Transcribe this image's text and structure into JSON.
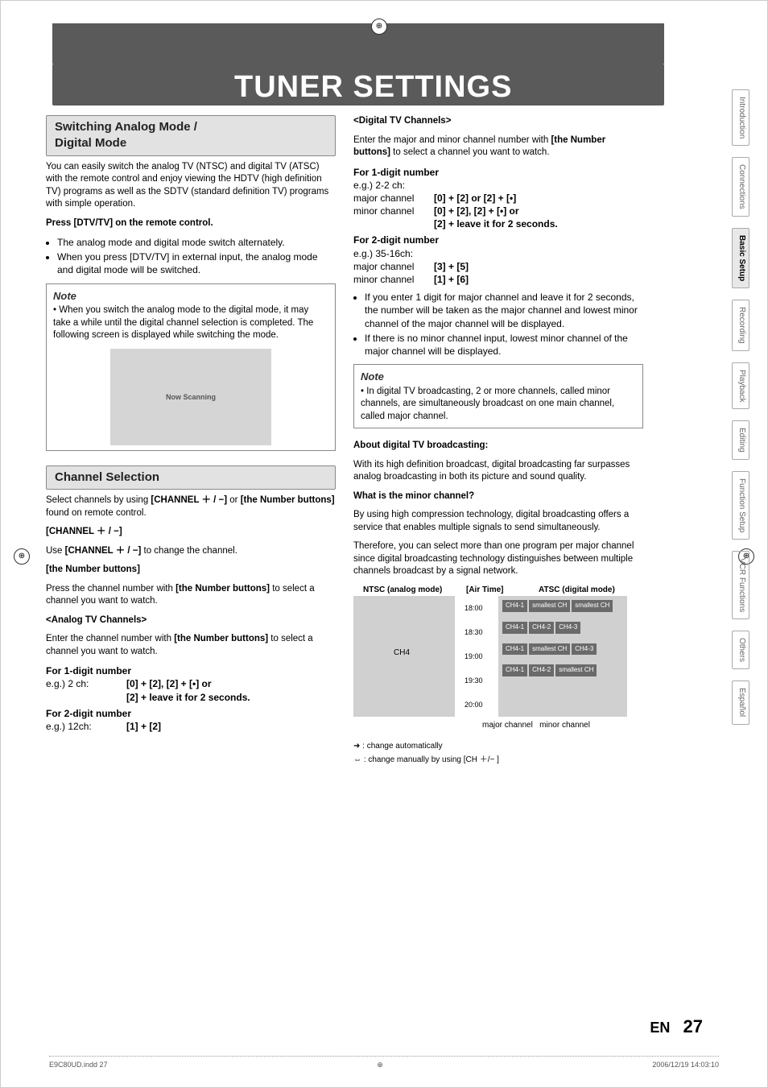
{
  "page": {
    "title": "TUNER SETTINGS",
    "lang": "EN",
    "num": "27",
    "footer_left": "E9C80UD.indd   27",
    "footer_right": "2006/12/19   14:03:10"
  },
  "tabs": [
    "Introduction",
    "Connections",
    "Basic Setup",
    "Recording",
    "Playback",
    "Editing",
    "Function Setup",
    "VCR Functions",
    "Others",
    "Español"
  ],
  "active_tab": "Basic Setup",
  "sec1": {
    "hdr": "Switching Analog Mode /\nDigital Mode",
    "p1": "You can easily switch the analog TV (NTSC) and digital TV (ATSC) with the remote control and enjoy viewing the HDTV (high definition TV) programs as well as the SDTV (standard definition TV) programs with simple operation.",
    "p2": "Press [DTV/TV] on the remote control.",
    "b1": "The analog mode and digital mode switch alternately.",
    "b2": "When you press [DTV/TV] in external input, the analog mode and digital mode will be switched.",
    "note_t": "Note",
    "note_b": "When you switch the analog mode to the digital mode, it may take a while until the digital channel selection is completed. The following screen is displayed while switching the mode.",
    "scan": "Now Scanning"
  },
  "sec2": {
    "hdr": "Channel Selection",
    "p1_a": "Select channels by using ",
    "p1_b": "[CHANNEL ＋ / −]",
    "p1_c": " or ",
    "p1_d": "[the Number buttons]",
    "p1_e": " found on remote control.",
    "h1": "[CHANNEL ＋ / −]",
    "p2_a": "Use ",
    "p2_b": "[CHANNEL ＋ / −]",
    "p2_c": " to change the channel.",
    "h2": "[the Number buttons]",
    "p3_a": "Press the channel number with ",
    "p3_b": "[the Number buttons]",
    "p3_c": " to select a channel you want to watch.",
    "h3": "<Analog TV Channels>",
    "p4_a": "Enter the channel number with ",
    "p4_b": "[the Number buttons]",
    "p4_c": " to select a channel you want to watch.",
    "h4": "For 1-digit number",
    "eg1": "e.g.) 2 ch:",
    "eg1v1": "[0] + [2], [2] + [•] or",
    "eg1v2": "[2] + leave it for 2 seconds.",
    "h5": "For 2-digit number",
    "eg2": "e.g.) 12ch:",
    "eg2v": "[1] + [2]"
  },
  "sec3": {
    "h1": "<Digital TV Channels>",
    "p1_a": "Enter the major and minor channel number with ",
    "p1_b": "[the Number buttons]",
    "p1_c": " to select a channel you want to watch.",
    "h2": "For 1-digit number",
    "eg1": "e.g.) 2-2 ch:",
    "mj": "major channel",
    "mn": "minor channel",
    "mjv": "[0] + [2] or [2] + [•]",
    "mnv1": "[0] + [2], [2] + [•] or",
    "mnv2": "[2] + leave it for 2 seconds.",
    "h3": "For 2-digit number",
    "eg2": "e.g.) 35-16ch:",
    "mjv2": "[3] + [5]",
    "mnv3": "[1] + [6]",
    "b1": "If you enter 1 digit for major channel and leave it for 2 seconds, the number will be taken as the major channel and lowest minor channel of the major channel will be displayed.",
    "b2": "If there is no minor channel input, lowest minor channel of the major channel will be displayed.",
    "note_t": "Note",
    "note_b": "In digital TV broadcasting, 2 or more channels, called minor channels, are simultaneously broadcast on one main channel, called major channel.",
    "h4": "About digital TV broadcasting:",
    "p2": "With its high definition broadcast, digital broadcasting far surpasses analog broadcasting in both its picture and sound quality.",
    "h5": "What is the minor channel?",
    "p3": "By using high compression technology, digital broadcasting offers a service that enables multiple signals to send simultaneously.",
    "p4": "Therefore, you can select more than one program per major channel since digital broadcasting technology distinguishes between multiple channels broadcast by a signal network."
  },
  "diag": {
    "ntsc": "NTSC (analog mode)",
    "air": "[Air Time]",
    "atsc": "ATSC (digital mode)",
    "ntsc_lbl": "CH4",
    "times": [
      "18:00",
      "18:30",
      "19:00",
      "19:30",
      "20:00"
    ],
    "cells": [
      "CH4-1",
      "smallest CH",
      "smallest CH",
      "CH4-1",
      "CH4-2",
      "CH4-3",
      "CH4-1",
      "smallest CH",
      "CH4-3",
      "CH4-1",
      "CH4-2",
      "smallest CH"
    ],
    "caption_major": "major channel",
    "caption_minor": "minor channel",
    "leg1": " : change automatically",
    "leg2": " : change manually by using [CH ＋/− ]"
  }
}
